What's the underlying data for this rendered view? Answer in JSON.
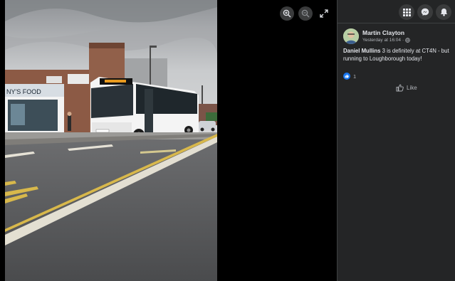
{
  "viewer": {
    "photo_alt": "",
    "tools": [
      {
        "name": "zoom-in-button",
        "icon": "zoom-in-icon"
      },
      {
        "name": "zoom-out-button",
        "icon": "zoom-out-icon"
      },
      {
        "name": "fullscreen-button",
        "icon": "expand-icon"
      }
    ],
    "shop_sign": "NY'S   FOOD"
  },
  "topbar": {
    "menu_icon": "grid-icon",
    "messenger_icon": "messenger-icon",
    "notifications_icon": "bell-icon"
  },
  "post": {
    "author": "Martin Clayton",
    "time": "Yesterday at 16:04",
    "separator": "·",
    "audience_icon": "globe-icon",
    "mention": "Daniel Mullins",
    "text": " 3 is definitely at CT4N - but running to Loughborough today!",
    "reaction_count": "1",
    "like_label": "Like"
  },
  "colors": {
    "panel_bg": "#242526",
    "text_primary": "#e4e6eb",
    "text_secondary": "#b0b3b8",
    "accent": "#1877f2"
  }
}
